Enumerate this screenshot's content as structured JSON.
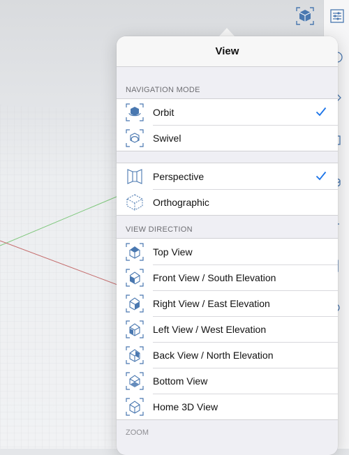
{
  "popover": {
    "title": "View",
    "sections": {
      "navigation_mode": {
        "label": "NAVIGATION MODE",
        "items": [
          {
            "label": "Orbit",
            "icon": "orbit-icon",
            "checked": true
          },
          {
            "label": "Swivel",
            "icon": "swivel-icon",
            "checked": false
          }
        ]
      },
      "projection": {
        "items": [
          {
            "label": "Perspective",
            "icon": "perspective-icon",
            "checked": true
          },
          {
            "label": "Orthographic",
            "icon": "orthographic-icon",
            "checked": false
          }
        ]
      },
      "view_direction": {
        "label": "VIEW DIRECTION",
        "items": [
          {
            "label": "Top View",
            "icon": "top-view-icon"
          },
          {
            "label": "Front View / South Elevation",
            "icon": "front-view-icon"
          },
          {
            "label": "Right View / East Elevation",
            "icon": "right-view-icon"
          },
          {
            "label": "Left View / West Elevation",
            "icon": "left-view-icon"
          },
          {
            "label": "Back View / North Elevation",
            "icon": "back-view-icon"
          },
          {
            "label": "Bottom View",
            "icon": "bottom-view-icon"
          },
          {
            "label": "Home 3D View",
            "icon": "home-3d-view-icon"
          }
        ]
      },
      "zoom": {
        "label": "ZOOM"
      }
    }
  },
  "colors": {
    "accent": "#1a73e8",
    "icon_blue": "#4a78b0",
    "axis_green": "#7dc77a",
    "axis_red": "#c46a6a"
  }
}
